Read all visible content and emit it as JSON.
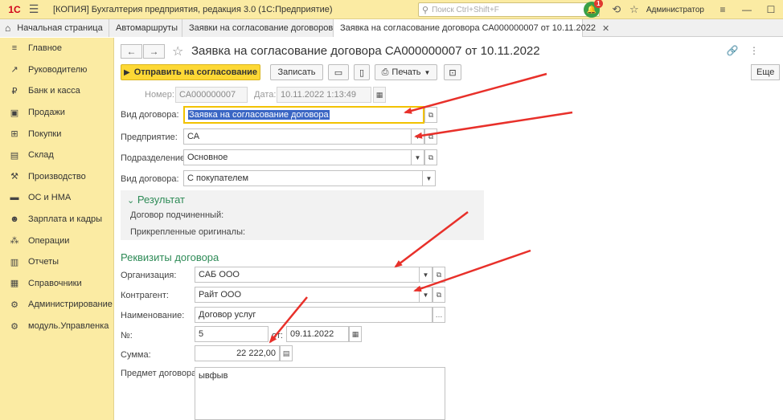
{
  "titlebar": {
    "logo": "1С",
    "title": "[КОПИЯ] Бухгалтерия предприятия, редакция 3.0  (1С:Предприятие)",
    "search_placeholder": "Поиск Ctrl+Shift+F",
    "notification_count": "1",
    "user": "Администратор"
  },
  "tabs": [
    {
      "label": "Начальная страница"
    },
    {
      "label": "Автомаршруты"
    },
    {
      "label": "Заявки на согласование договоров"
    },
    {
      "label": "Заявка на согласование договора СА000000007 от 10.11.2022"
    }
  ],
  "sidebar": {
    "items": [
      {
        "label": "Главное",
        "icon": "menu-icon"
      },
      {
        "label": "Руководителю",
        "icon": "chart-line-icon"
      },
      {
        "label": "Банк и касса",
        "icon": "ruble-icon"
      },
      {
        "label": "Продажи",
        "icon": "cart-sales-icon"
      },
      {
        "label": "Покупки",
        "icon": "cart-icon"
      },
      {
        "label": "Склад",
        "icon": "warehouse-icon"
      },
      {
        "label": "Производство",
        "icon": "factory-icon"
      },
      {
        "label": "ОС и НМА",
        "icon": "assets-icon"
      },
      {
        "label": "Зарплата и кадры",
        "icon": "people-icon"
      },
      {
        "label": "Операции",
        "icon": "operations-icon"
      },
      {
        "label": "Отчеты",
        "icon": "reports-icon"
      },
      {
        "label": "Справочники",
        "icon": "books-icon"
      },
      {
        "label": "Администрирование",
        "icon": "gear-icon"
      },
      {
        "label": "модуль.Управленка",
        "icon": "gear-small-icon"
      }
    ]
  },
  "form": {
    "title": "Заявка на согласование договора СА000000007 от 10.11.2022",
    "toolbar": {
      "send_label": "Отправить на согласование",
      "save_label": "Записать",
      "print_label": "Печать",
      "more_label": "Еще"
    },
    "number_label": "Номер:",
    "number_value": "СА000000007",
    "date_label": "Дата:",
    "date_value": "10.11.2022  1:13:49",
    "contract_kind_label": "Вид договора:",
    "contract_kind_value": "Заявка на согласование договора",
    "enterprise_label": "Предприятие:",
    "enterprise_value": "СА",
    "division_label": "Подразделение:",
    "division_value": "Основное",
    "contract_type_label": "Вид договора:",
    "contract_type_value": "С покупателем",
    "result": {
      "title": "Результат",
      "subordinate_label": "Договор подчиненный:",
      "originals_label": "Прикрепленные оригиналы:"
    },
    "requisites": {
      "title": "Реквизиты договора",
      "org_label": "Организация:",
      "org_value": "САБ ООО",
      "counterparty_label": "Контрагент:",
      "counterparty_value": "Райт ООО",
      "name_label": "Наименование:",
      "name_value": "Договор услуг",
      "num_label": "№:",
      "num_value": "5",
      "from_label": "от:",
      "from_value": "09.11.2022",
      "sum_label": "Сумма:",
      "sum_value": "22 222,00",
      "subject_label": "Предмет договора:",
      "subject_value": "ывфыв"
    }
  },
  "colors": {
    "sidebar_bg": "#fbeba3",
    "primary_button": "#fdd835",
    "section_title": "#2e8b57",
    "arrow": "#e8302a"
  }
}
